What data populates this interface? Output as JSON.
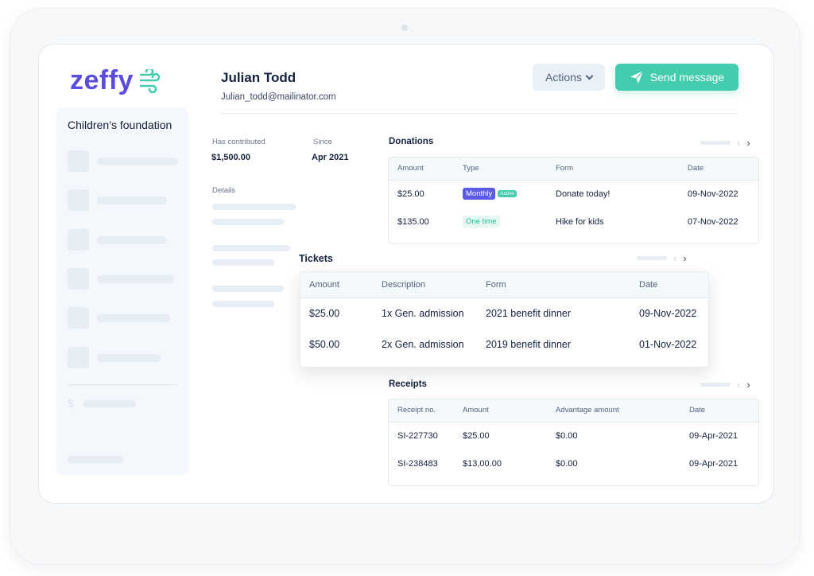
{
  "app": {
    "logo_text": "zeffy",
    "brand_color": "#5b4ce0",
    "accent_color": "#45cbad"
  },
  "sidebar": {
    "organization": "Children’s foundation",
    "currency_icon": "$"
  },
  "donor": {
    "name": "Julian Todd",
    "email": "Julian_todd@mailinator.com"
  },
  "header": {
    "actions_label": "Actions",
    "send_label": "Send message"
  },
  "stats": {
    "contributed_label": "Has contributed",
    "contributed_value": "$1,500.00",
    "since_label": "Since",
    "since_value": "Apr 2021",
    "details_label": "Details"
  },
  "donations": {
    "title": "Donations",
    "columns": [
      "Amount",
      "Type",
      "Form",
      "Date"
    ],
    "rows": [
      {
        "amount": "$25.00",
        "type": "Monthly",
        "status": "Active",
        "form": "Donate today!",
        "date": "09-Nov-2022"
      },
      {
        "amount": "$135.00",
        "type": "One time",
        "form": "Hike for kids",
        "date": "07-Nov-2022"
      }
    ]
  },
  "tickets": {
    "title": "Tickets",
    "columns": [
      "Amount",
      "Description",
      "Form",
      "Date"
    ],
    "rows": [
      {
        "amount": "$25.00",
        "description": "1x Gen. admission",
        "form": "2021 benefit dinner",
        "date": "09-Nov-2022"
      },
      {
        "amount": "$50.00",
        "description": "2x Gen. admission",
        "form": "2019 benefit dinner",
        "date": "01-Nov-2022"
      }
    ]
  },
  "receipts": {
    "title": "Receipts",
    "columns": [
      "Receipt no.",
      "Amount",
      "Advantage amount",
      "Date"
    ],
    "rows": [
      {
        "number": "SI-227730",
        "amount": "$25.00",
        "advantage": "$0.00",
        "date": "09-Apr-2021"
      },
      {
        "number": "SI-238483",
        "amount": "$13,00.00",
        "advantage": "$0.00",
        "date": "09-Apr-2021"
      }
    ]
  },
  "pager": {
    "prev": "‹",
    "next": "›"
  }
}
